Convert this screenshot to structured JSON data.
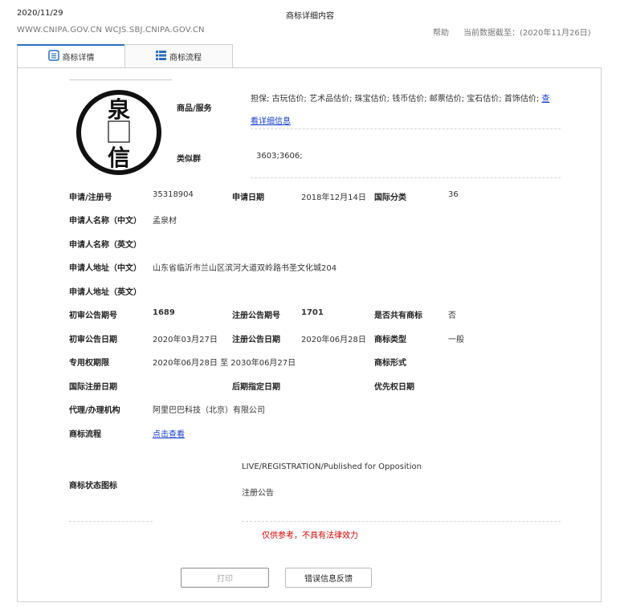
{
  "header": {
    "date": "2020/11/29",
    "title": "商标详细内容",
    "domains": "WWW.CNIPA.GOV.CN WCJS.SBJ.CNIPA.GOV.CN",
    "help": "帮助",
    "data_date": "当前数据截至：(2020年11月26日)"
  },
  "tabs": [
    {
      "label": "商标详情",
      "active": true
    },
    {
      "label": "商标流程",
      "active": false
    }
  ],
  "logo": {
    "chars": [
      "泉",
      "信"
    ]
  },
  "goods": {
    "label": "商品/服务",
    "text": "担保; 古玩估价; 艺术品估价; 珠宝估价; 钱币估价; 邮票估价; 宝石估价; 首饰估价;",
    "link_part1": "查",
    "link_part2": "看详细信息"
  },
  "similar": {
    "label": "类似群",
    "value": "3603;3606;"
  },
  "fields": {
    "reg_no_label": "申请/注册号",
    "reg_no": "35318904",
    "app_date_label": "申请日期",
    "app_date": "2018年12月14日",
    "intl_class_label": "国际分类",
    "intl_class": "36",
    "applicant_cn_label": "申请人名称（中文）",
    "applicant_cn": "孟泉材",
    "applicant_en_label": "申请人名称（英文）",
    "address_cn_label": "申请人地址（中文）",
    "address_cn": "山东省临沂市兰山区滨河大道双岭路书圣文化城204",
    "address_en_label": "申请人地址（英文）",
    "prelim_no_label": "初审公告期号",
    "prelim_no": "1689",
    "reg_pub_no_label": "注册公告期号",
    "reg_pub_no": "1701",
    "shared_label": "是否共有商标",
    "shared": "否",
    "prelim_date_label": "初审公告日期",
    "prelim_date": "2020年03月27日",
    "reg_pub_date_label": "注册公告日期",
    "reg_pub_date": "2020年06月28日",
    "mark_type_label": "商标类型",
    "mark_type": "一般",
    "exclusive_label": "专用权期限",
    "exclusive": "2020年06月28日 至 2030年06月27日",
    "mark_form_label": "商标形式",
    "intl_reg_date_label": "国际注册日期",
    "later_date_label": "后期指定日期",
    "priority_date_label": "优先权日期",
    "agent_label": "代理/办理机构",
    "agent": "阿里巴巴科技（北京）有限公司",
    "flow_label": "商标流程",
    "flow_link": "点击查看",
    "status_label": "商标状态图标",
    "status_en": "LIVE/REGISTRATION/Published for Opposition",
    "status_cn": "注册公告"
  },
  "disclaimer": "仅供参考，不具有法律效力",
  "buttons": {
    "print": "打印",
    "report": "错误信息反馈"
  },
  "colors": {
    "accent_blue": "#2a6fbf",
    "link_blue": "#1a3fcf",
    "disclaimer_red": "#d40000"
  }
}
